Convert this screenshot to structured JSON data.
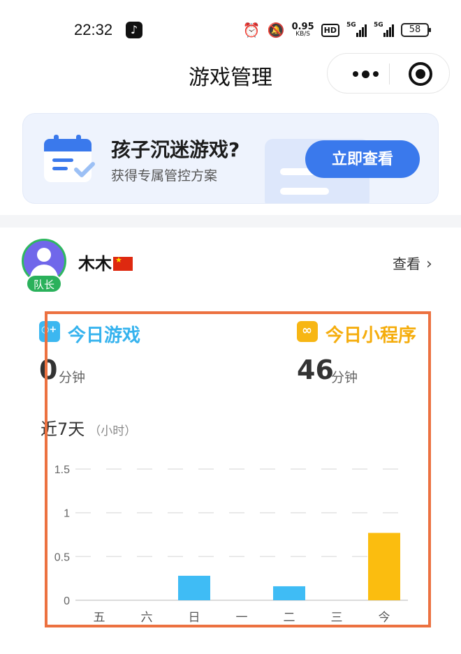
{
  "status_bar": {
    "time": "22:32",
    "net_speed": "0.95",
    "net_unit": "KB/S",
    "hd": "HD",
    "signal1": "5G",
    "signal2": "5G",
    "battery": "58"
  },
  "nav": {
    "title": "游戏管理"
  },
  "banner": {
    "title": "孩子沉迷游戏?",
    "subtitle": "获得专属管控方案",
    "button": "立即查看"
  },
  "user": {
    "name": "木木",
    "badge": "队长",
    "view_label": "查看"
  },
  "stats": {
    "games_label": "今日游戏",
    "games_value": "0",
    "games_unit": "分钟",
    "mini_label": "今日小程序",
    "mini_value": "46",
    "mini_unit": "分钟"
  },
  "chart_section": {
    "title": "近7天",
    "subtitle": "（小时）"
  },
  "colors": {
    "accent_blue": "#3a79ec",
    "game_blue": "#36b3ee",
    "mini_orange": "#f5ad0d",
    "badge_green": "#2ab15b",
    "highlight": "#ec7140"
  },
  "chart_data": {
    "type": "bar",
    "categories": [
      "五",
      "六",
      "日",
      "一",
      "二",
      "三",
      "今"
    ],
    "ylim": [
      0,
      1.5
    ],
    "yticks": [
      "0",
      "0.5",
      "1",
      "1.5"
    ],
    "grid": "dashed-horizontal",
    "series": [
      {
        "values": [
          0,
          0,
          0.28,
          0,
          0.16,
          0,
          0
        ],
        "color": "#3fbcf5"
      },
      {
        "values": [
          0,
          0,
          0,
          0,
          0,
          0,
          0.77
        ],
        "color": "#fbbd0f"
      }
    ]
  }
}
